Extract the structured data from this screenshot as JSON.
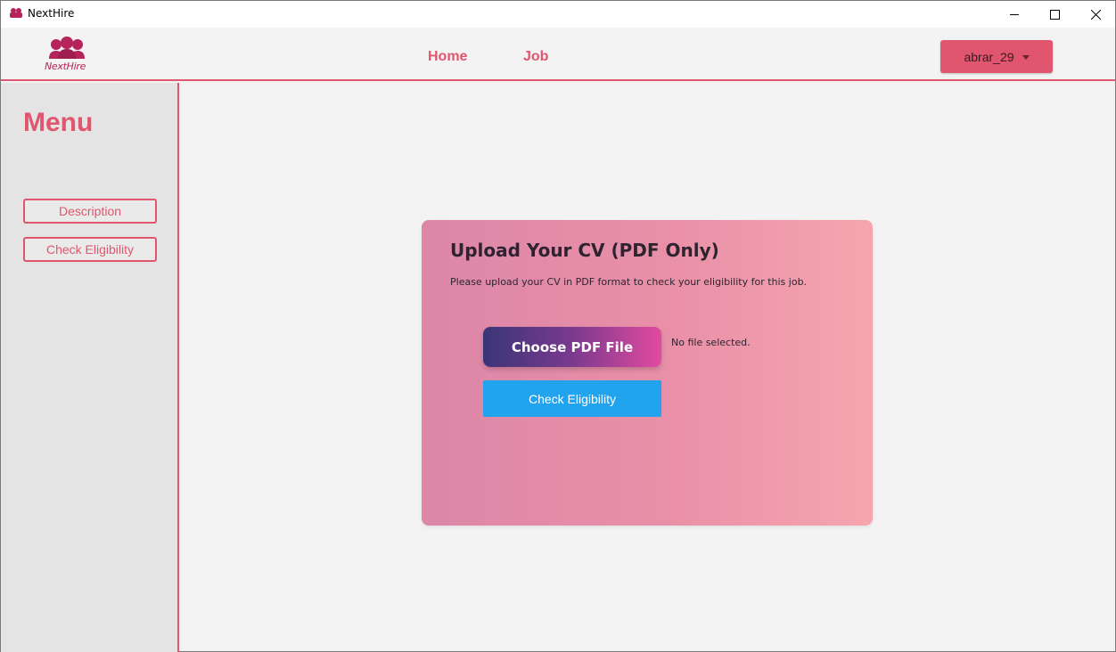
{
  "window": {
    "title": "NextHire",
    "controls": [
      "minimize-icon",
      "maximize-icon",
      "close-icon"
    ]
  },
  "header": {
    "logo_text": "NextHire",
    "nav": {
      "home": "Home",
      "job": "Job"
    },
    "user_menu": {
      "label": "abrar_29"
    }
  },
  "sidebar": {
    "title": "Menu",
    "items": [
      {
        "label": "Description"
      },
      {
        "label": "Check Eligibility"
      }
    ]
  },
  "upload_card": {
    "title": "Upload Your CV (PDF Only)",
    "subtitle": "Please upload your CV in PDF format to check your eligibility for this job.",
    "choose_button": "Choose PDF File",
    "file_status": "No file selected.",
    "check_button": "Check Eligibility"
  },
  "colors": {
    "accent": "#e0566e",
    "brand": "#b5245a",
    "check_button": "#22a3ee",
    "card_gradient_start": "#dc86a8",
    "card_gradient_end": "#f6a5af"
  }
}
